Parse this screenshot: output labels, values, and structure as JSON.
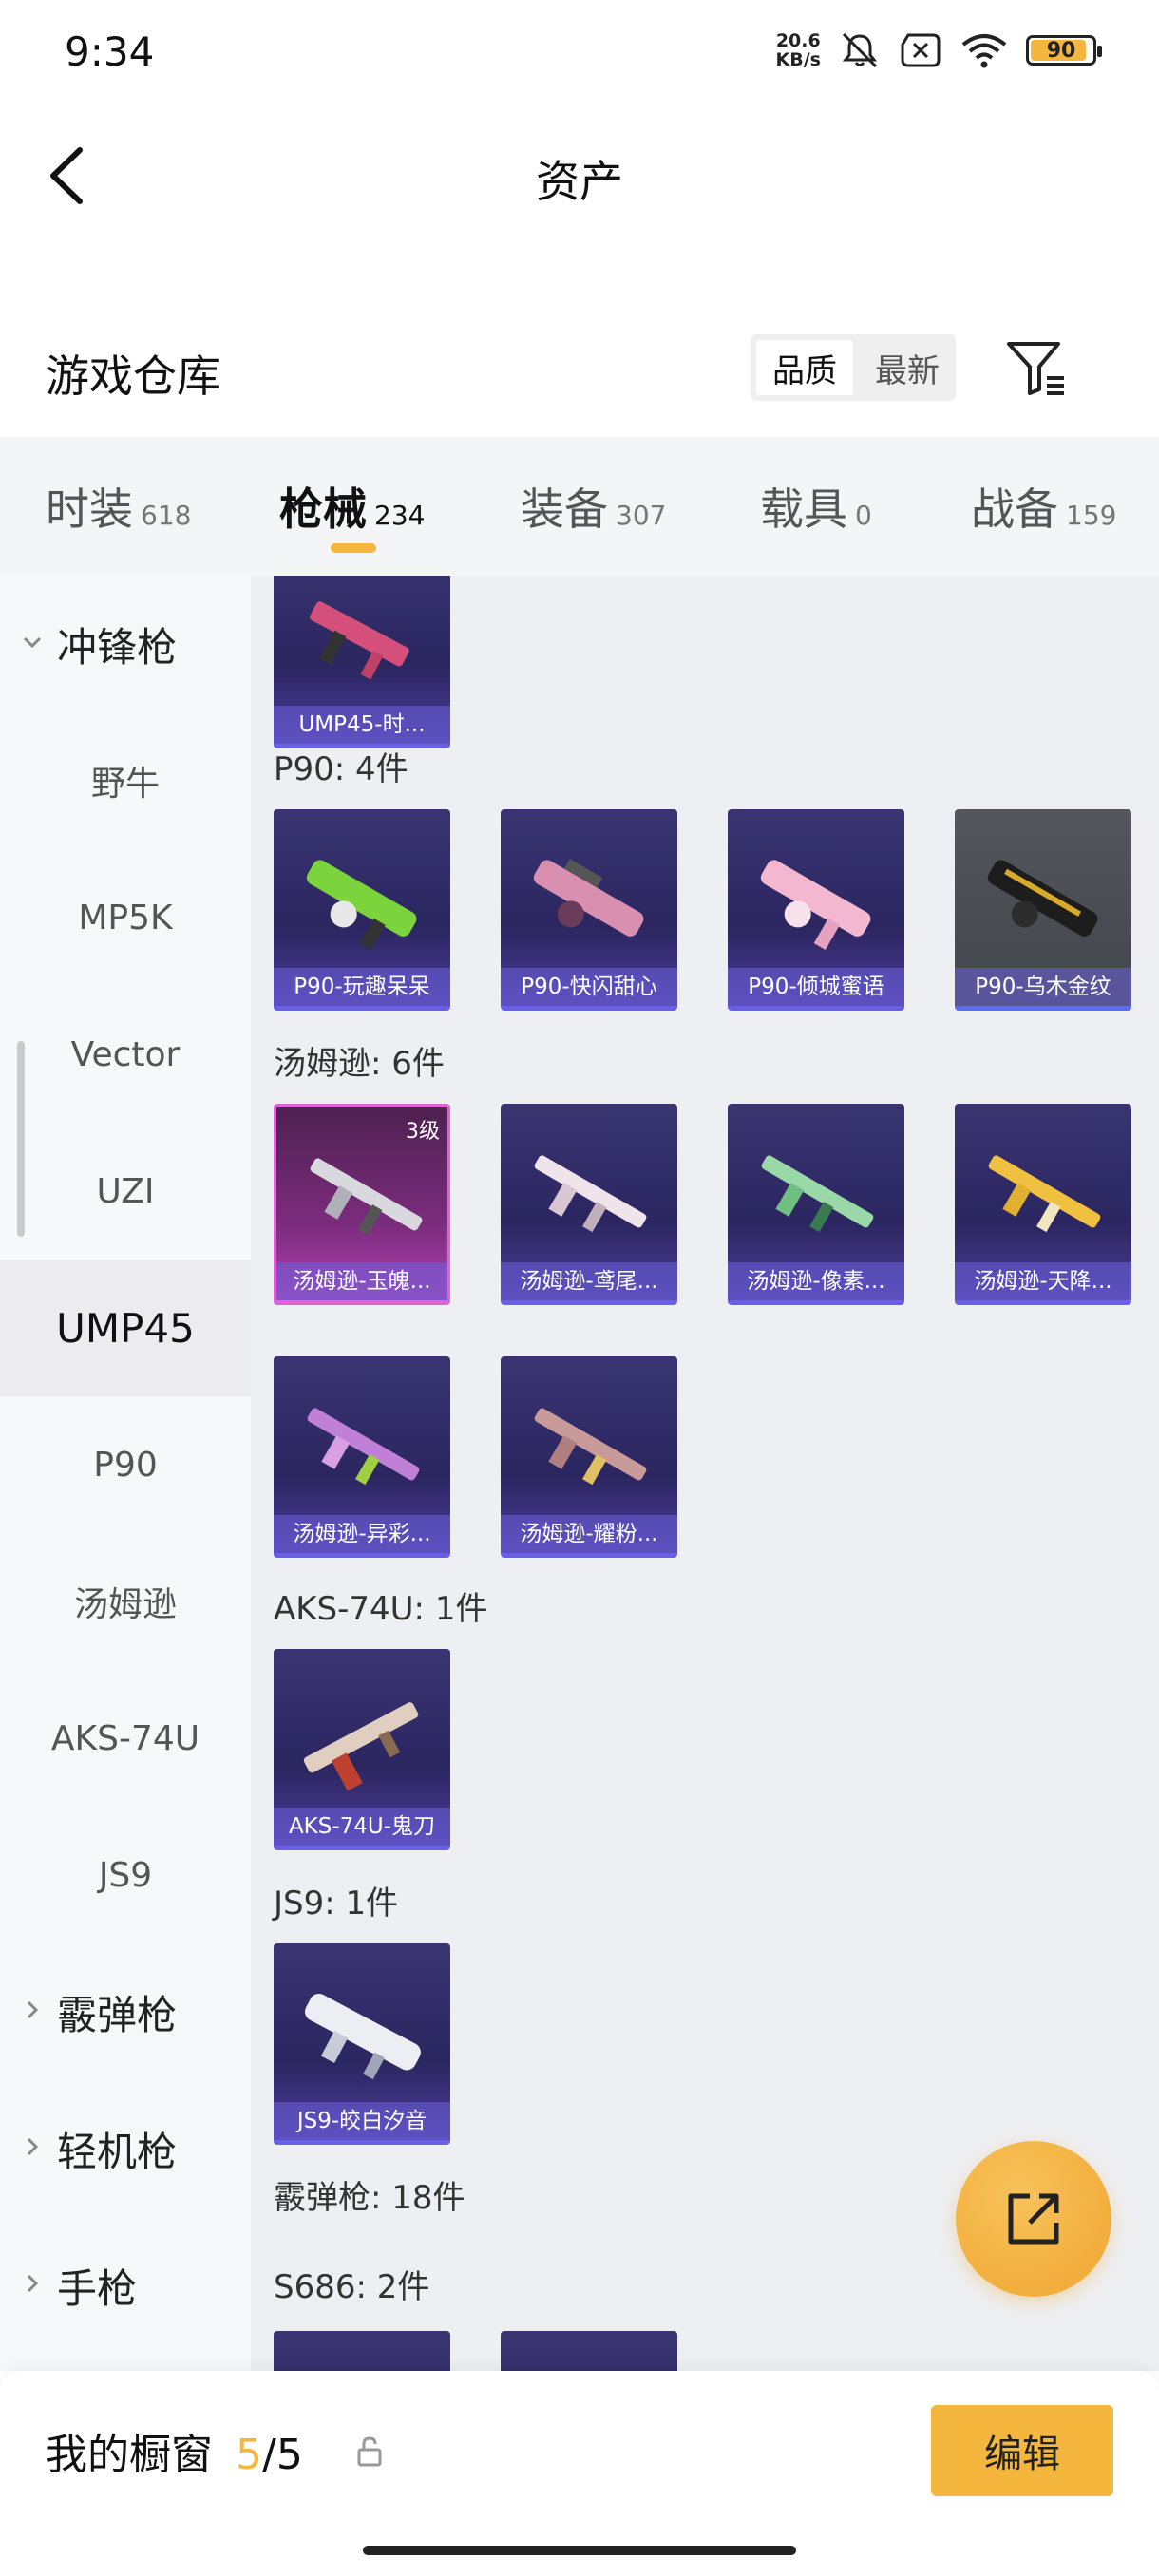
{
  "status_bar": {
    "time": "9:34",
    "net_speed_top": "20.6",
    "net_speed_bottom": "KB/s",
    "battery": "90",
    "battery_fraction": 0.9
  },
  "header": {
    "title": "资产"
  },
  "warehouse": {
    "title": "游戏仓库",
    "sort_options": [
      "品质",
      "最新"
    ],
    "active_sort": "品质"
  },
  "tabs": [
    {
      "label": "时装",
      "count": "618"
    },
    {
      "label": "枪械",
      "count": "234",
      "active": true
    },
    {
      "label": "装备",
      "count": "307"
    },
    {
      "label": "载具",
      "count": "0"
    },
    {
      "label": "战备",
      "count": "159"
    }
  ],
  "sidebar": [
    {
      "label": "冲锋枪",
      "type": "group",
      "expanded": true
    },
    {
      "label": "野牛"
    },
    {
      "label": "MP5K"
    },
    {
      "label": "Vector"
    },
    {
      "label": "UZI"
    },
    {
      "label": "UMP45",
      "active": true
    },
    {
      "label": "P90"
    },
    {
      "label": "汤姆逊"
    },
    {
      "label": "AKS-74U"
    },
    {
      "label": "JS9"
    },
    {
      "label": "霰弹枪",
      "type": "group"
    },
    {
      "label": "轻机枪",
      "type": "group"
    },
    {
      "label": "手枪",
      "type": "group"
    }
  ],
  "content": {
    "partial_card": "UMP45-时...",
    "sections": [
      {
        "title": "P90: 4件",
        "items": [
          "P90-玩趣呆呆",
          "P90-快闪甜心",
          "P90-倾城蜜语",
          "P90-乌木金纹"
        ]
      },
      {
        "title": "汤姆逊: 6件",
        "items": [
          "汤姆逊-玉魄...",
          "汤姆逊-鸢尾...",
          "汤姆逊-像素...",
          "汤姆逊-天降...",
          "汤姆逊-异彩...",
          "汤姆逊-耀粉..."
        ],
        "first_item_level": "3级"
      },
      {
        "title": "AKS-74U: 1件",
        "items": [
          "AKS-74U-鬼刀"
        ]
      },
      {
        "title": "JS9: 1件",
        "items": [
          "JS9-皎白汐音"
        ]
      },
      {
        "title": "霰弹枪: 18件",
        "items": []
      },
      {
        "title": "S686: 2件",
        "items": []
      }
    ]
  },
  "bottom": {
    "showcase_label": "我的橱窗",
    "showcase_current": "5",
    "showcase_total": "/5",
    "edit_label": "编辑"
  },
  "colors": {
    "accent": "#f4b63c",
    "card_purple": "#3a3572",
    "card_pink": "#b040b0"
  }
}
